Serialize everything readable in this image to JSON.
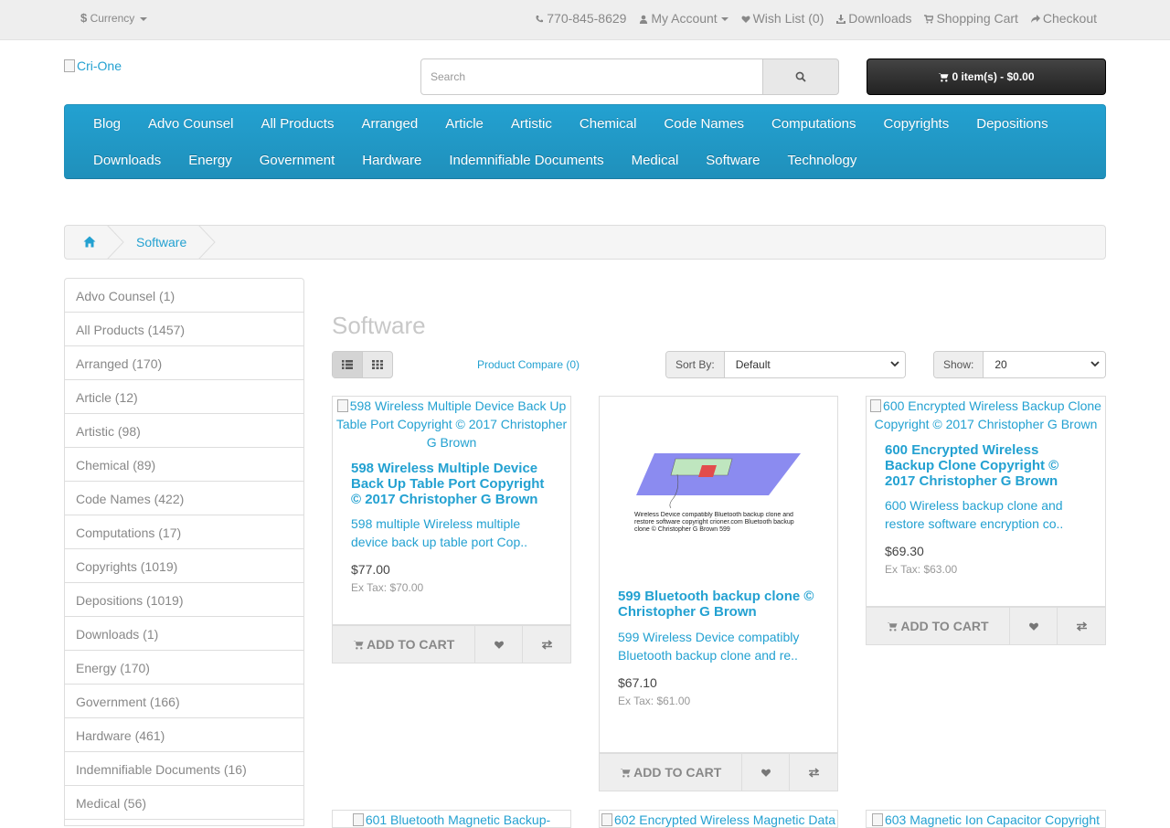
{
  "topbar": {
    "currency_symbol": "$",
    "currency_label": "Currency",
    "phone": "770-845-8629",
    "my_account": "My Account",
    "wish_list": "Wish List (0)",
    "downloads": "Downloads",
    "shopping_cart": "Shopping Cart",
    "checkout": "Checkout"
  },
  "header": {
    "logo_alt": "Cri-One",
    "search_placeholder": "Search",
    "cart_button": "0 item(s) - $0.00"
  },
  "menu": {
    "row1": [
      "Blog",
      "Advo Counsel",
      "All Products",
      "Arranged",
      "Article",
      "Artistic",
      "Chemical",
      "Code Names",
      "Computations",
      "Copyrights",
      "Depositions"
    ],
    "row2": [
      "Downloads",
      "Energy",
      "Government",
      "Hardware",
      "Indemnifiable Documents",
      "Medical",
      "Software",
      "Technology"
    ]
  },
  "breadcrumb": {
    "current": "Software"
  },
  "sidebar": {
    "categories": [
      "Advo Counsel (1)",
      "All Products (1457)",
      "Arranged (170)",
      "Article (12)",
      "Artistic (98)",
      "Chemical (89)",
      "Code Names (422)",
      "Computations (17)",
      "Copyrights (1019)",
      "Depositions (1019)",
      "Downloads (1)",
      "Energy (170)",
      "Government (166)",
      "Hardware (461)",
      "Indemnifiable Documents (16)",
      "Medical (56)"
    ]
  },
  "content": {
    "title": "Software",
    "product_compare": "Product Compare (0)",
    "sort_label": "Sort By:",
    "sort_value": "Default",
    "show_label": "Show:",
    "show_value": "20"
  },
  "products": [
    {
      "image_alt": "598 Wireless Multiple Device Back Up Table Port Copyright © 2017 Christopher G Brown",
      "name": "598 Wireless Multiple Device Back Up Table Port Copyright © 2017 Christopher G Brown",
      "description": "598 multiple  Wireless multiple device back up table port Cop..",
      "price": "$77.00",
      "ex_tax": "Ex Tax: $70.00",
      "add_to_cart": "Add to Cart"
    },
    {
      "image_caption": "Wireless Device compatibly Bluetooth backup clone and restore software copyright crioner.com Bluetooth backup clone © Christopher G Brown 599",
      "name": "599 Bluetooth backup clone © Christopher G Brown",
      "description": "599 Wireless Device compatibly Bluetooth backup clone and re..",
      "price": "$67.10",
      "ex_tax": "Ex Tax: $61.00",
      "add_to_cart": "Add to Cart"
    },
    {
      "image_alt": "600 Encrypted Wireless Backup Clone Copyright © 2017 Christopher G Brown",
      "name": "600 Encrypted Wireless Backup Clone Copyright © 2017 Christopher G Brown",
      "description": "600 Wireless backup clone and restore software encryption co..",
      "price": "$69.30",
      "ex_tax": "Ex Tax: $63.00",
      "add_to_cart": "Add to Cart"
    }
  ],
  "next_row_alts": [
    "601 Bluetooth Magnetic Backup-",
    "602 Encrypted Wireless Magnetic Data",
    "603 Magnetic Ion Capacitor Copyright"
  ],
  "colors": {
    "accent": "#23a1d1",
    "menu_bg": "#229ac8",
    "topbar_bg": "#eeeeee",
    "cart_bg": "#303030"
  }
}
